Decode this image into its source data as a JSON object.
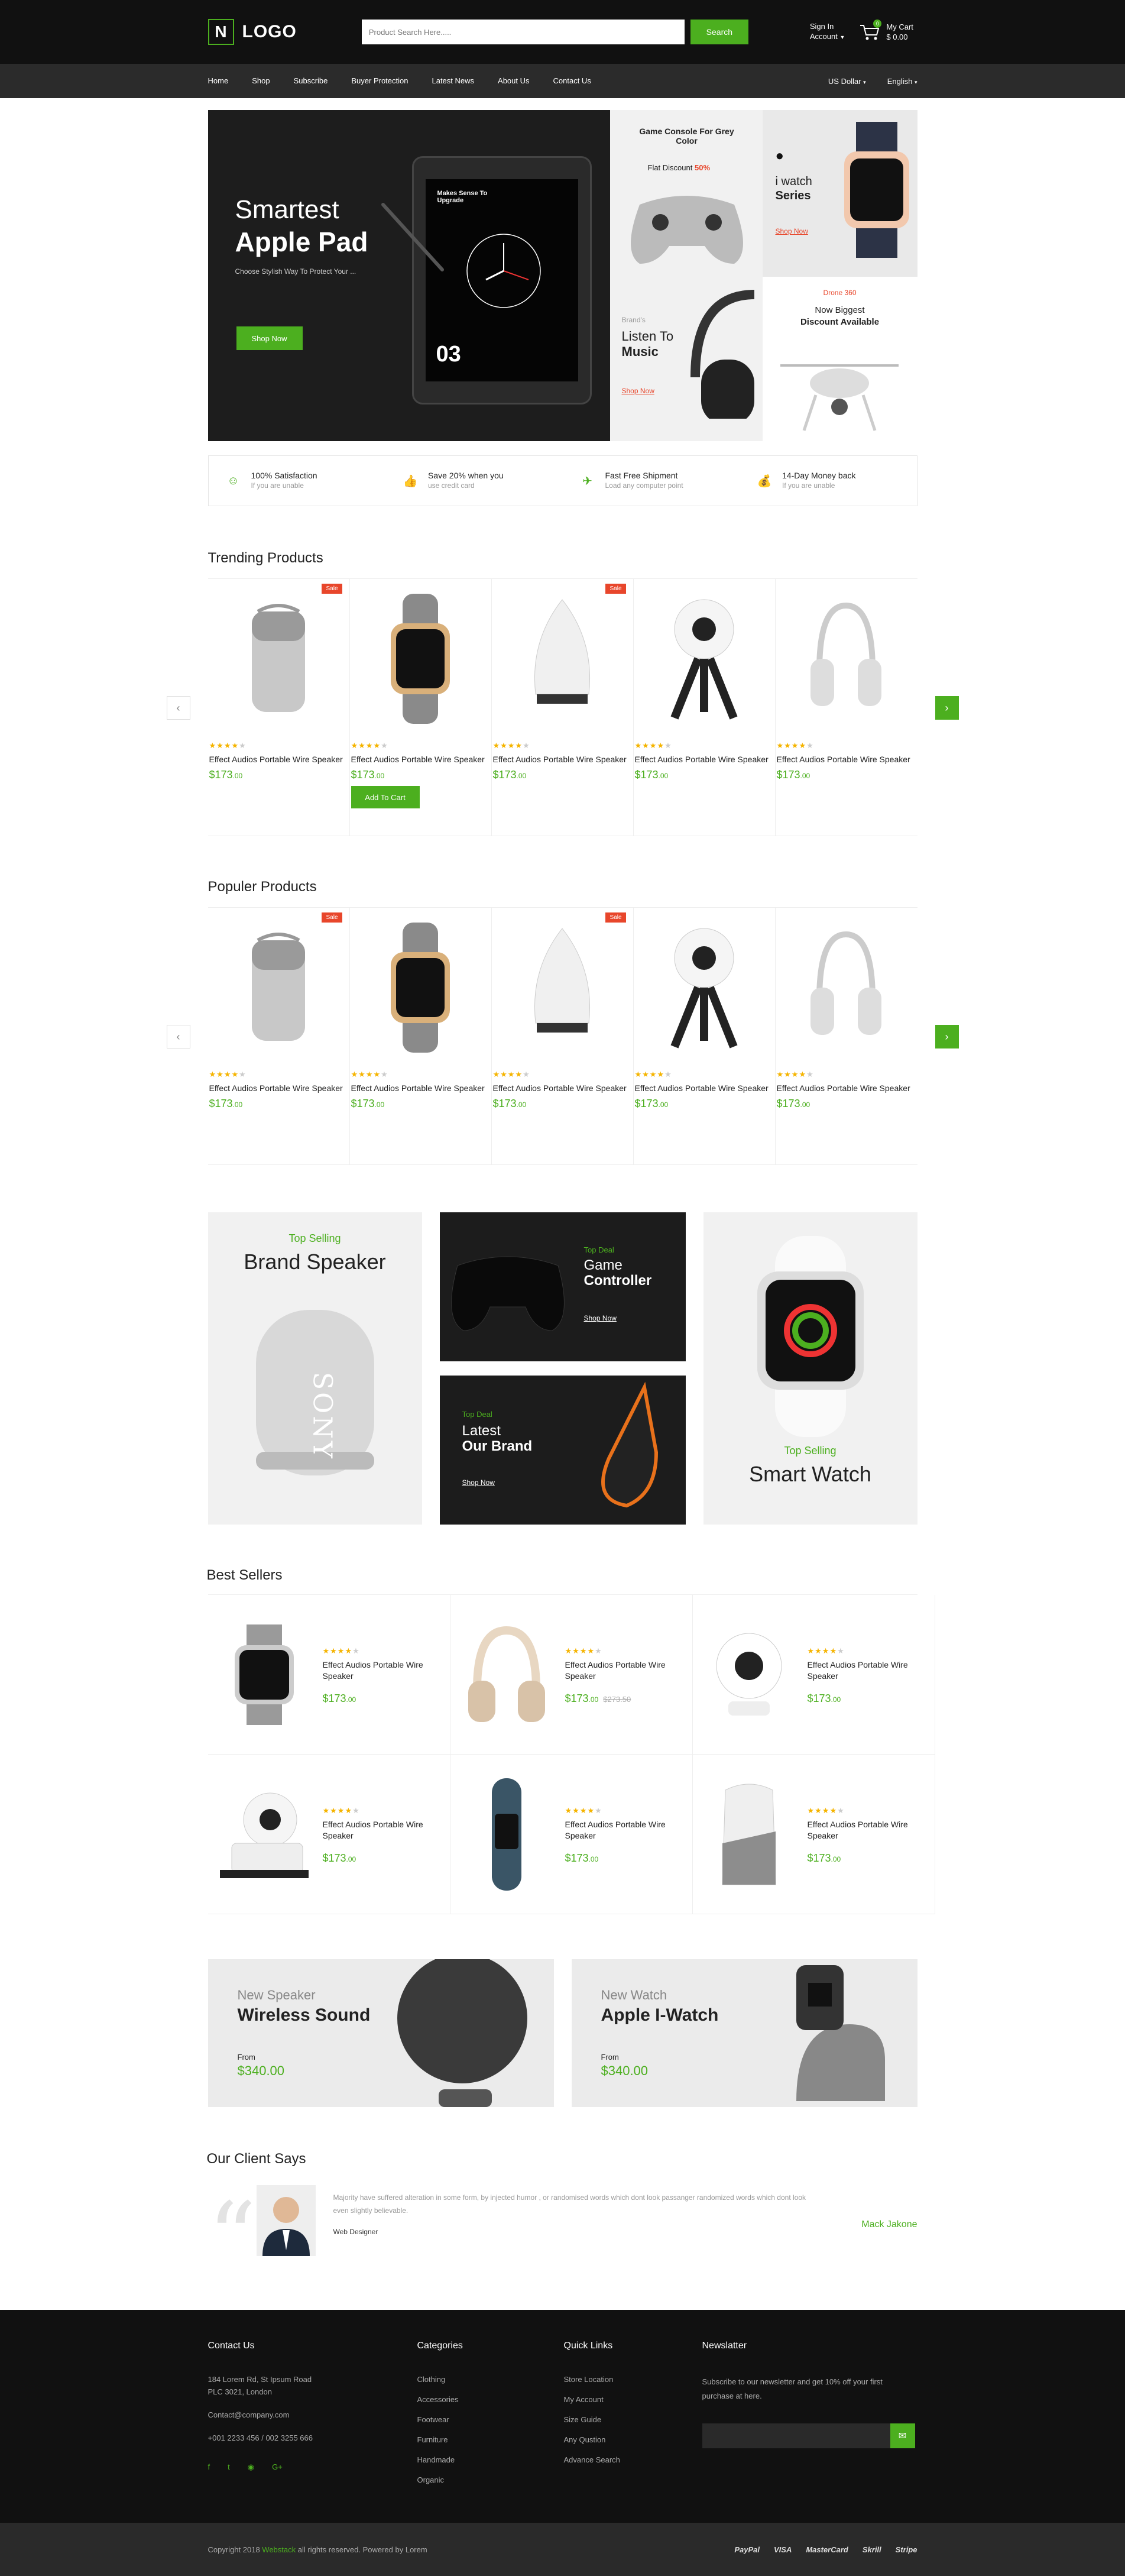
{
  "header": {
    "logo_letter": "N",
    "logo_text": "LOGO",
    "search_placeholder": "Product Search Here.....",
    "search_button": "Search",
    "signin_line1": "Sign In",
    "signin_line2": "Account",
    "cart_label": "My Cart",
    "cart_total": "$ 0.00",
    "cart_count": "0"
  },
  "nav": {
    "items": [
      "Home",
      "Shop",
      "Subscribe",
      "Buyer Protection",
      "Latest News",
      "About Us",
      "Contact Us"
    ],
    "currency": "US Dollar",
    "language": "English"
  },
  "hero": {
    "line1": "Smartest",
    "line2": "Apple Pad",
    "subtitle": "Choose Stylish Way To Protect Your ...",
    "button": "Shop Now",
    "tablet_caption": "Makes Sense To Upgrade",
    "tablet_number": "03",
    "tiles": {
      "console_title": "Game Console For Grey Color",
      "console_discount_pre": "Flat Discount",
      "console_discount_val": "50%",
      "iwatch_line1": "i watch",
      "iwatch_line2": "Series",
      "iwatch_link": "Shop Now",
      "music_pre": "Brand's",
      "music_line1": "Listen To",
      "music_line2": "Music",
      "music_link": "Shop Now",
      "drone_tag": "Drone 360",
      "drone_line1": "Now Biggest",
      "drone_line2": "Discount Available"
    }
  },
  "features": [
    {
      "title": "100% Satisfaction",
      "sub": "If you are unable",
      "icon": "smile-icon"
    },
    {
      "title": "Save 20% when you",
      "sub": "use credit card",
      "icon": "thumbs-up-icon"
    },
    {
      "title": "Fast Free Shipment",
      "sub": "Load any computer point",
      "icon": "plane-icon"
    },
    {
      "title": "14-Day Money back",
      "sub": "If you are unable",
      "icon": "money-bag-icon"
    }
  ],
  "trending": {
    "title": "Trending Products",
    "add_to_cart": "Add To Cart",
    "products": [
      {
        "name": "Effect Audios Portable Wire Speaker",
        "price": "$173",
        "cents": ".00",
        "sale": "Sale",
        "rating": 4
      },
      {
        "name": "Effect Audios Portable Wire Speaker",
        "price": "$173",
        "cents": ".00",
        "sale": "",
        "rating": 4
      },
      {
        "name": "Effect Audios Portable Wire Speaker",
        "price": "$173",
        "cents": ".00",
        "sale": "Sale",
        "rating": 4
      },
      {
        "name": "Effect Audios Portable Wire Speaker",
        "price": "$173",
        "cents": ".00",
        "sale": "",
        "rating": 4
      },
      {
        "name": "Effect Audios Portable Wire Speaker",
        "price": "$173",
        "cents": ".00",
        "sale": "",
        "rating": 4
      }
    ]
  },
  "popular": {
    "title": "Populer  Products",
    "products": [
      {
        "name": "Effect Audios Portable Wire Speaker",
        "price": "$173",
        "cents": ".00",
        "sale": "Sale",
        "rating": 4
      },
      {
        "name": "Effect Audios Portable Wire Speaker",
        "price": "$173",
        "cents": ".00",
        "sale": "",
        "rating": 4
      },
      {
        "name": "Effect Audios Portable Wire Speaker",
        "price": "$173",
        "cents": ".00",
        "sale": "Sale",
        "rating": 4
      },
      {
        "name": "Effect Audios Portable Wire Speaker",
        "price": "$173",
        "cents": ".00",
        "sale": "",
        "rating": 4
      },
      {
        "name": "Effect Audios Portable Wire Speaker",
        "price": "$173",
        "cents": ".00",
        "sale": "",
        "rating": 4
      }
    ]
  },
  "promo": {
    "speaker_tag": "Top Selling",
    "speaker_title": "Brand Speaker",
    "speaker_brand": "SONY",
    "controller_tag": "Top Deal",
    "controller_line1": "Game",
    "controller_line2": "Controller",
    "controller_link": "Shop Now",
    "brand_tag": "Top Deal",
    "brand_line1": "Latest",
    "brand_line2": "Our Brand",
    "brand_link": "Shop Now",
    "watch_tag": "Top Selling",
    "watch_title": "Smart Watch"
  },
  "bestsellers": {
    "title": "Best Sellers",
    "items": [
      {
        "name": "Effect Audios Portable Wire Speaker",
        "price": "$173",
        "cents": ".00",
        "old": ""
      },
      {
        "name": "Effect Audios Portable Wire Speaker",
        "price": "$173",
        "cents": ".00",
        "old": "$273.50"
      },
      {
        "name": "Effect Audios Portable Wire Speaker",
        "price": "$173",
        "cents": ".00",
        "old": ""
      },
      {
        "name": "Effect Audios Portable Wire Speaker",
        "price": "$173",
        "cents": ".00",
        "old": ""
      },
      {
        "name": "Effect Audios Portable Wire Speaker",
        "price": "$173",
        "cents": ".00",
        "old": ""
      },
      {
        "name": "Effect Audios Portable Wire Speaker",
        "price": "$173",
        "cents": ".00",
        "old": ""
      }
    ]
  },
  "banners": [
    {
      "sub": "New Speaker",
      "title": "Wireless Sound",
      "from": "From",
      "price": "$340.00"
    },
    {
      "sub": "New Watch",
      "title": "Apple I-Watch",
      "from": "From",
      "price": "$340.00"
    }
  ],
  "testimonial": {
    "title": "Our Client Says",
    "text": "Majority have suffered alteration in some form, by injected humor , or randomised words which dont look  passanger randomized words which dont look even slightly believable.",
    "role": "Web Designer",
    "name": "Mack Jakone"
  },
  "footer": {
    "contact_title": "Contact Us",
    "address1": "184 Lorem Rd, St Ipsum Road",
    "address2": "PLC 3021, London",
    "email": "Contact@company.com",
    "phone": "+001 2233 456 / 002 3255 666",
    "categories_title": "Categories",
    "categories": [
      "Clothing",
      "Accessories",
      "Footwear",
      "Furniture",
      "Handmade",
      "Organic"
    ],
    "links_title": "Quick Links",
    "links": [
      "Store Location",
      "My Account",
      "Size Guide",
      "Any Qustion",
      "Advance Search"
    ],
    "news_title": "Newslatter",
    "news_text": "Subscribe to our newsletter and get 10% off your first purchase at here.",
    "copyright_pre": "Copyright 2018",
    "copyright_brand": "Webstack",
    "copyright_post": "all rights reserved. Powered by Lorem",
    "payments": [
      "PayPal",
      "VISA",
      "MasterCard",
      "Skrill",
      "Stripe"
    ]
  }
}
